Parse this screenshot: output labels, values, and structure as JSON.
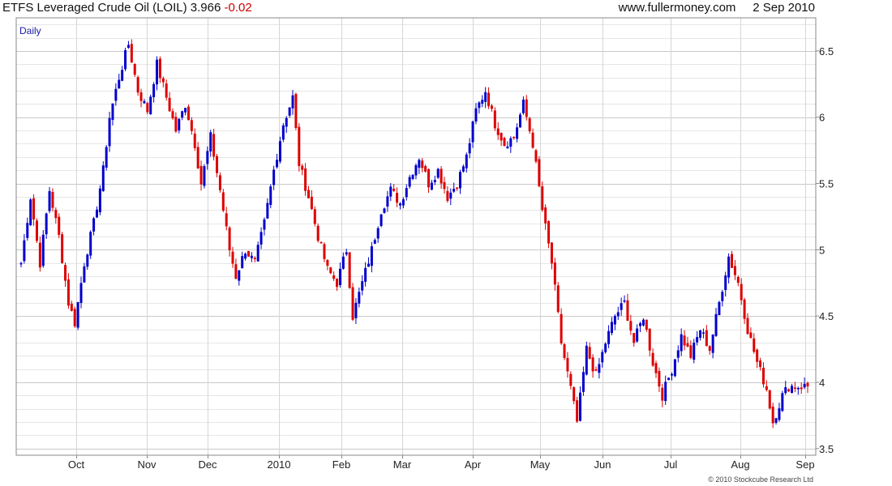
{
  "header": {
    "title": "ETFS Leveraged Crude Oil (LOIL)",
    "price": "3.966",
    "change": "-0.02",
    "site": "www.fullermoney.com",
    "date": "2 Sep 2010"
  },
  "copyright": "© 2010 Stockcube Research Ltd",
  "colors": {
    "up": "#0000cc",
    "down": "#dd0000",
    "grid": "#d6d6d6",
    "frame": "#888888"
  },
  "chart_data": {
    "type": "ohlc",
    "period": "Daily",
    "ylim": [
      3.45,
      6.75
    ],
    "y_ticks": [
      3.5,
      4,
      4.5,
      5,
      5.5,
      6,
      6.5
    ],
    "x_labels": [
      "Oct",
      "Nov",
      "Dec",
      "2010",
      "Feb",
      "Mar",
      "Apr",
      "May",
      "Jun",
      "Jul",
      "Aug",
      "Sep"
    ],
    "close_series": [
      {
        "t": 0,
        "close": 4.9
      },
      {
        "t": 3,
        "close": 5.4
      },
      {
        "t": 6,
        "close": 4.9
      },
      {
        "t": 9,
        "close": 5.45
      },
      {
        "t": 12,
        "close": 5.1
      },
      {
        "t": 15,
        "close": 4.6
      },
      {
        "t": 17,
        "close": 4.45
      },
      {
        "t": 20,
        "close": 4.9
      },
      {
        "t": 23,
        "close": 5.2
      },
      {
        "t": 26,
        "close": 5.6
      },
      {
        "t": 28,
        "close": 6.0
      },
      {
        "t": 31,
        "close": 6.3
      },
      {
        "t": 34,
        "close": 6.55
      },
      {
        "t": 37,
        "close": 6.2
      },
      {
        "t": 40,
        "close": 6.05
      },
      {
        "t": 43,
        "close": 6.4
      },
      {
        "t": 46,
        "close": 6.15
      },
      {
        "t": 49,
        "close": 5.9
      },
      {
        "t": 52,
        "close": 6.1
      },
      {
        "t": 55,
        "close": 5.8
      },
      {
        "t": 57,
        "close": 5.5
      },
      {
        "t": 60,
        "close": 5.85
      },
      {
        "t": 63,
        "close": 5.45
      },
      {
        "t": 66,
        "close": 5.0
      },
      {
        "t": 68,
        "close": 4.8
      },
      {
        "t": 71,
        "close": 5.0
      },
      {
        "t": 74,
        "close": 4.9
      },
      {
        "t": 77,
        "close": 5.2
      },
      {
        "t": 80,
        "close": 5.6
      },
      {
        "t": 83,
        "close": 5.95
      },
      {
        "t": 86,
        "close": 6.15
      },
      {
        "t": 88,
        "close": 5.65
      },
      {
        "t": 91,
        "close": 5.4
      },
      {
        "t": 94,
        "close": 5.1
      },
      {
        "t": 97,
        "close": 4.85
      },
      {
        "t": 100,
        "close": 4.75
      },
      {
        "t": 103,
        "close": 5.0
      },
      {
        "t": 105,
        "close": 4.5
      },
      {
        "t": 108,
        "close": 4.75
      },
      {
        "t": 111,
        "close": 5.0
      },
      {
        "t": 114,
        "close": 5.3
      },
      {
        "t": 117,
        "close": 5.45
      },
      {
        "t": 120,
        "close": 5.35
      },
      {
        "t": 123,
        "close": 5.55
      },
      {
        "t": 126,
        "close": 5.7
      },
      {
        "t": 129,
        "close": 5.5
      },
      {
        "t": 132,
        "close": 5.6
      },
      {
        "t": 135,
        "close": 5.4
      },
      {
        "t": 138,
        "close": 5.5
      },
      {
        "t": 141,
        "close": 5.7
      },
      {
        "t": 144,
        "close": 6.05
      },
      {
        "t": 147,
        "close": 6.2
      },
      {
        "t": 150,
        "close": 5.95
      },
      {
        "t": 153,
        "close": 5.8
      },
      {
        "t": 156,
        "close": 5.85
      },
      {
        "t": 159,
        "close": 6.1
      },
      {
        "t": 162,
        "close": 5.8
      },
      {
        "t": 165,
        "close": 5.3
      },
      {
        "t": 168,
        "close": 4.9
      },
      {
        "t": 171,
        "close": 4.3
      },
      {
        "t": 174,
        "close": 3.95
      },
      {
        "t": 176,
        "close": 3.7
      },
      {
        "t": 179,
        "close": 4.25
      },
      {
        "t": 182,
        "close": 4.05
      },
      {
        "t": 185,
        "close": 4.3
      },
      {
        "t": 188,
        "close": 4.5
      },
      {
        "t": 191,
        "close": 4.6
      },
      {
        "t": 194,
        "close": 4.3
      },
      {
        "t": 197,
        "close": 4.5
      },
      {
        "t": 200,
        "close": 4.15
      },
      {
        "t": 203,
        "close": 3.9
      },
      {
        "t": 206,
        "close": 4.1
      },
      {
        "t": 209,
        "close": 4.35
      },
      {
        "t": 212,
        "close": 4.2
      },
      {
        "t": 215,
        "close": 4.4
      },
      {
        "t": 218,
        "close": 4.25
      },
      {
        "t": 221,
        "close": 4.6
      },
      {
        "t": 224,
        "close": 4.95
      },
      {
        "t": 227,
        "close": 4.75
      },
      {
        "t": 230,
        "close": 4.4
      },
      {
        "t": 233,
        "close": 4.15
      },
      {
        "t": 236,
        "close": 3.95
      },
      {
        "t": 238,
        "close": 3.7
      },
      {
        "t": 241,
        "close": 3.9
      },
      {
        "t": 243,
        "close": 3.97
      }
    ]
  }
}
